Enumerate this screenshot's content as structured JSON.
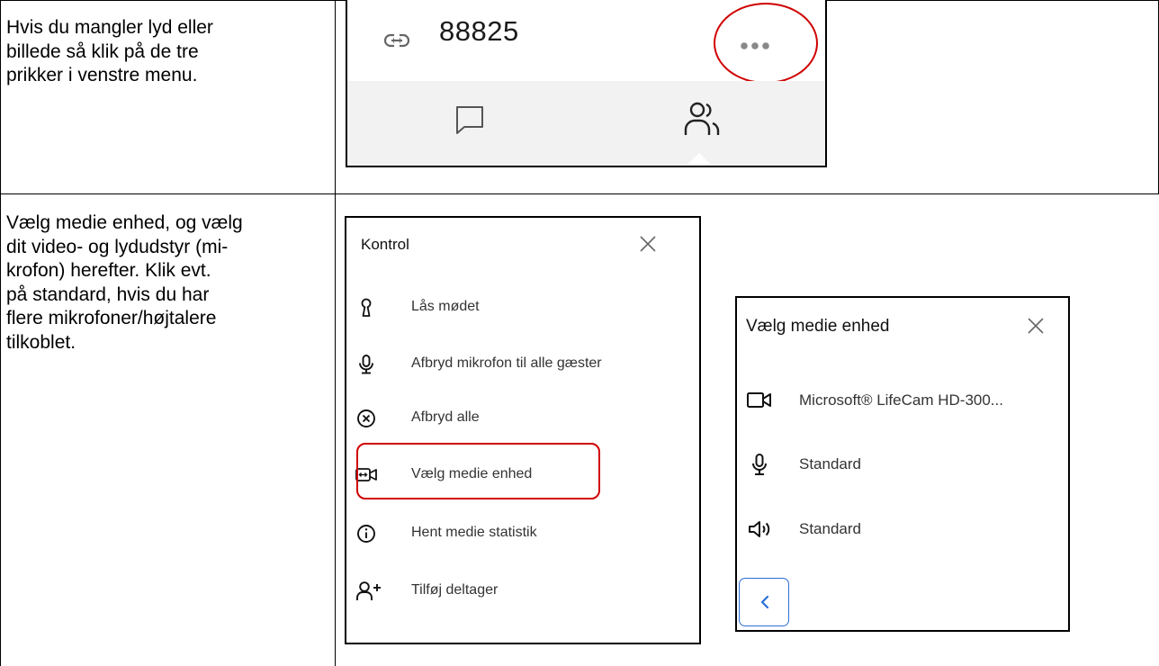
{
  "rows": [
    {
      "instruction": "Hvis du mangler lyd eller billede så klik på de tre prikker i venstre menu."
    },
    {
      "instruction": "Vælg medie enhed, og vælg dit video- og lydudstyr (mikrofon) herefter. Klik evt. på standard, hvis du har flere mikrofoner/højtalere tilkoblet."
    }
  ],
  "instruction_lines": {
    "row1": [
      "Hvis du mangler lyd eller",
      "billede så klik på de tre",
      "prikker i venstre menu."
    ],
    "row2": [
      "Vælg medie enhed, og vælg",
      "dit video- og lydudstyr (mi-",
      "krofon) herefter. Klik evt.",
      "på standard, hvis du har",
      "flere mikrofoner/højtalere",
      "tilkoblet."
    ]
  },
  "meeting_header": {
    "link_icon": "link-icon",
    "meeting_code": "88825",
    "more_icon": "more-dots-icon",
    "tabs": [
      {
        "icon": "chat-icon"
      },
      {
        "icon": "participants-icon"
      }
    ],
    "highlight_color": "#d00000"
  },
  "control_panel": {
    "title": "Kontrol",
    "items": [
      {
        "label": "Lås mødet",
        "icon": "keyhole-icon"
      },
      {
        "label": "Afbryd mikrofon til alle gæster",
        "icon": "microphone-icon"
      },
      {
        "label": "Afbryd alle",
        "icon": "x-circle-icon"
      },
      {
        "label": "Vælg medie enhed",
        "icon": "media-device-icon",
        "highlighted": true
      },
      {
        "label": "Hent medie statistik",
        "icon": "info-icon"
      },
      {
        "label": "Tilføj deltager",
        "icon": "add-person-icon"
      }
    ]
  },
  "media_panel": {
    "title": "Vælg medie enhed",
    "camera": {
      "label": "Microsoft® LifeCam HD-300...",
      "icon": "camera-icon"
    },
    "microphone": {
      "label": "Standard",
      "icon": "microphone-icon"
    },
    "speaker": {
      "label": "Standard",
      "icon": "speaker-icon"
    },
    "back_icon": "chevron-left-icon",
    "accent": "#2b6fd6"
  }
}
